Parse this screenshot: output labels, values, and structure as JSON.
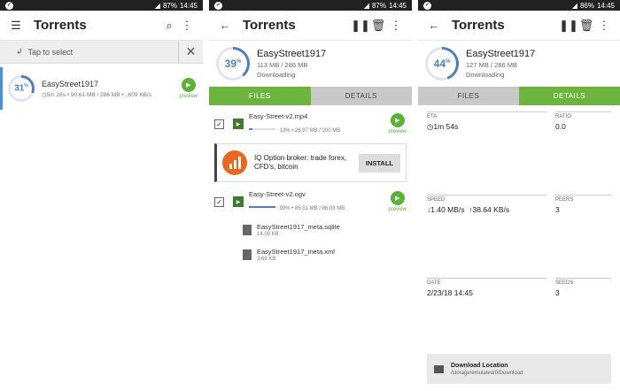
{
  "status": {
    "s1": {
      "battery": "87%",
      "time": "14:45"
    },
    "s2": {
      "battery": "87%",
      "time": "14:45"
    },
    "s3": {
      "battery": "86%",
      "time": "14:45"
    }
  },
  "list_screen": {
    "title": "Torrents",
    "select_label": "Tap to select",
    "torrent": {
      "progress": "31",
      "progress_value": 31,
      "name": "EasyStreet1917",
      "eta": "5m 28s",
      "size": "90.61 MB / 286 MB",
      "speed": "609 KB/s",
      "preview_label": "preview"
    }
  },
  "files_screen": {
    "title": "Torrents",
    "progress": "39",
    "progress_value": 39,
    "name": "EasyStreet1917",
    "size": "113 MB / 286 MB",
    "state": "Downloading",
    "tab_files": "FILES",
    "tab_details": "DETAILS",
    "files": [
      {
        "name": "Easy-Street-v2.mp4",
        "meta": "13% • 26.97 MB / 200 MB",
        "progress": 13,
        "preview": "preview",
        "checked": true
      },
      {
        "name": "Easy-Street-v2.ogv",
        "meta": "99% • 85.51 MB / 86.03 MB",
        "progress": 99,
        "preview": "preview",
        "checked": true
      }
    ],
    "docs": [
      {
        "name": "EasyStreet1917_meta.sqlite",
        "meta": "14.00 KB"
      },
      {
        "name": "EasyStreet1917_meta.xml",
        "meta": "3.68 KB"
      }
    ],
    "ad": {
      "text": "IQ Option broker: trade forex, CFD's, bitcoin",
      "button": "INSTALL"
    }
  },
  "details_screen": {
    "title": "Torrents",
    "progress": "44",
    "progress_value": 44,
    "name": "EasyStreet1917",
    "size": "127 MB / 286 MB",
    "state": "Downloading",
    "tab_files": "FILES",
    "tab_details": "DETAILS",
    "eta_label": "ETA",
    "eta_value": "1m 54s",
    "ratio_label": "RATIO",
    "ratio_value": "0.0",
    "speed_label": "SPEED",
    "speed_down": "1.40 MB/s",
    "speed_up": "38.64 KB/s",
    "peers_label": "PEERS",
    "peers_value": "3",
    "date_label": "DATE",
    "date_value": "2/23/18 14:45",
    "seeds_label": "SEEDS",
    "seeds_value": "3",
    "location_title": "Download Location",
    "location_path": "/storage/emulated/0/Download"
  },
  "colors": {
    "accent": "#6cb33f",
    "ring": "#4f7ec0",
    "statusbar": "#222222"
  },
  "icons": [
    "menu-icon",
    "search-icon",
    "more-icon",
    "back-icon",
    "pause-icon",
    "delete-icon",
    "close-icon",
    "play-icon",
    "video-file-icon",
    "document-icon",
    "folder-icon",
    "clock-icon",
    "arrow-down-icon",
    "arrow-up-icon"
  ]
}
